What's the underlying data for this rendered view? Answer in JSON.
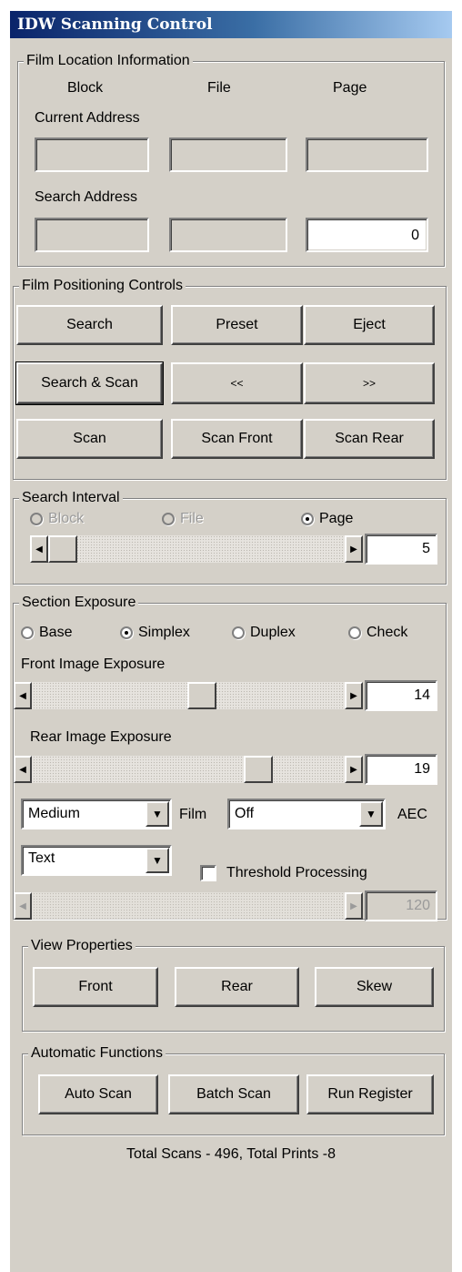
{
  "title": "IDW Scanning Control",
  "film_location": {
    "legend": "Film Location Information",
    "col_block": "Block",
    "col_file": "File",
    "col_page": "Page",
    "current_label": "Current Address",
    "search_label": "Search Address",
    "current": {
      "block": "",
      "file": "",
      "page": ""
    },
    "search": {
      "block": "",
      "file": "",
      "page": "0"
    }
  },
  "positioning": {
    "legend": "Film Positioning Controls",
    "search": "Search",
    "preset": "Preset",
    "eject": "Eject",
    "search_scan": "Search & Scan",
    "prev": "<<",
    "next": ">>",
    "scan": "Scan",
    "scan_front": "Scan Front",
    "scan_rear": "Scan Rear"
  },
  "interval": {
    "legend": "Search Interval",
    "block": "Block",
    "file": "File",
    "page": "Page",
    "selected": "page",
    "value": "5",
    "level": 0.0
  },
  "exposure": {
    "legend": "Section Exposure",
    "base": "Base",
    "simplex": "Simplex",
    "duplex": "Duplex",
    "check": "Check",
    "selected": "simplex",
    "front_label": "Front Image Exposure",
    "front_value": "14",
    "front_level": 0.55,
    "rear_label": "Rear Image Exposure",
    "rear_value": "19",
    "rear_level": 0.75,
    "film_combo": "Medium",
    "film_label": "Film",
    "aec_combo": "Off",
    "aec_label": "AEC",
    "text_combo": "Text",
    "threshold_label": "Threshold Processing",
    "threshold_checked": false,
    "threshold_value": "120"
  },
  "view": {
    "legend": "View Properties",
    "front": "Front",
    "rear": "Rear",
    "skew": "Skew"
  },
  "automatic": {
    "legend": "Automatic Functions",
    "auto_scan": "Auto Scan",
    "batch_scan": "Batch Scan",
    "run_register": "Run Register"
  },
  "status": "Total Scans - 496, Total Prints -8"
}
